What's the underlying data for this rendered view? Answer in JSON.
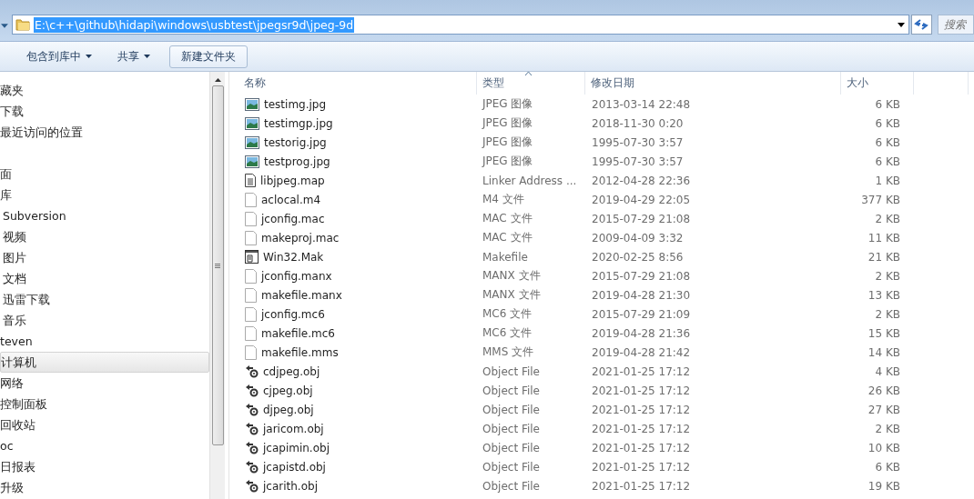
{
  "address_bar": {
    "path": "E:\\c++\\github\\hidapi\\windows\\usbtest\\jpegsr9d\\jpeg-9d",
    "text_selected": true
  },
  "search": {
    "placeholder": "搜索"
  },
  "toolbar": [
    {
      "label": "包含到库中",
      "dropdown": true
    },
    {
      "label": "共享",
      "dropdown": true
    },
    {
      "label": "新建文件夹",
      "dropdown": false
    }
  ],
  "sidebar": {
    "items": [
      {
        "label": "藏夹",
        "selected": false
      },
      {
        "label": "下载",
        "selected": false
      },
      {
        "label": "最近访问的位置",
        "selected": false
      },
      {
        "label": "面",
        "selected": false
      },
      {
        "label": "库",
        "selected": false,
        "children": [
          {
            "label": "Subversion",
            "selected": false
          },
          {
            "label": "视频",
            "selected": false
          },
          {
            "label": "图片",
            "selected": false
          },
          {
            "label": "文档",
            "selected": false
          },
          {
            "label": "迅雷下载",
            "selected": false
          },
          {
            "label": "音乐",
            "selected": false
          }
        ]
      },
      {
        "label": "teven",
        "selected": false
      },
      {
        "label": "计算机",
        "selected": true
      },
      {
        "label": "网络",
        "selected": false
      },
      {
        "label": "控制面板",
        "selected": false
      },
      {
        "label": "回收站",
        "selected": false
      },
      {
        "label": "oc",
        "selected": false
      },
      {
        "label": "日报表",
        "selected": false
      },
      {
        "label": "升级",
        "selected": false
      }
    ]
  },
  "table": {
    "columns": [
      {
        "label": "名称",
        "sorted": false
      },
      {
        "label": "类型",
        "sorted": true
      },
      {
        "label": "修改日期",
        "sorted": false
      },
      {
        "label": "大小",
        "sorted": false
      }
    ],
    "rows": [
      {
        "kind": "image",
        "name": "testimg.jpg",
        "type": "JPEG 图像",
        "date": "2013-03-14 22:48",
        "size": "6 KB"
      },
      {
        "kind": "image",
        "name": "testimgp.jpg",
        "type": "JPEG 图像",
        "date": "2018-11-30 0:20",
        "size": "6 KB"
      },
      {
        "kind": "image",
        "name": "testorig.jpg",
        "type": "JPEG 图像",
        "date": "1995-07-30 3:57",
        "size": "6 KB"
      },
      {
        "kind": "image",
        "name": "testprog.jpg",
        "type": "JPEG 图像",
        "date": "1995-07-30 3:57",
        "size": "6 KB"
      },
      {
        "kind": "text",
        "name": "libjpeg.map",
        "type": "Linker Address ...",
        "date": "2012-04-28 22:36",
        "size": "1 KB"
      },
      {
        "kind": "blank",
        "name": "aclocal.m4",
        "type": "M4 文件",
        "date": "2019-04-29 22:05",
        "size": "377 KB"
      },
      {
        "kind": "blank",
        "name": "jconfig.mac",
        "type": "MAC 文件",
        "date": "2015-07-29 21:08",
        "size": "2 KB"
      },
      {
        "kind": "blank",
        "name": "makeproj.mac",
        "type": "MAC 文件",
        "date": "2009-04-09 3:32",
        "size": "11 KB"
      },
      {
        "kind": "makefile",
        "name": "Win32.Mak",
        "type": "Makefile",
        "date": "2020-02-25 8:56",
        "size": "21 KB"
      },
      {
        "kind": "blank",
        "name": "jconfig.manx",
        "type": "MANX 文件",
        "date": "2015-07-29 21:08",
        "size": "2 KB"
      },
      {
        "kind": "blank",
        "name": "makefile.manx",
        "type": "MANX 文件",
        "date": "2019-04-28 21:30",
        "size": "13 KB"
      },
      {
        "kind": "blank",
        "name": "jconfig.mc6",
        "type": "MC6 文件",
        "date": "2015-07-29 21:09",
        "size": "2 KB"
      },
      {
        "kind": "blank",
        "name": "makefile.mc6",
        "type": "MC6 文件",
        "date": "2019-04-28 21:36",
        "size": "15 KB"
      },
      {
        "kind": "blank",
        "name": "makefile.mms",
        "type": "MMS 文件",
        "date": "2019-04-28 21:42",
        "size": "14 KB"
      },
      {
        "kind": "object",
        "name": "cdjpeg.obj",
        "type": "Object File",
        "date": "2021-01-25 17:12",
        "size": "4 KB"
      },
      {
        "kind": "object",
        "name": "cjpeg.obj",
        "type": "Object File",
        "date": "2021-01-25 17:12",
        "size": "26 KB"
      },
      {
        "kind": "object",
        "name": "djpeg.obj",
        "type": "Object File",
        "date": "2021-01-25 17:12",
        "size": "27 KB"
      },
      {
        "kind": "object",
        "name": "jaricom.obj",
        "type": "Object File",
        "date": "2021-01-25 17:12",
        "size": "2 KB"
      },
      {
        "kind": "object",
        "name": "jcapimin.obj",
        "type": "Object File",
        "date": "2021-01-25 17:12",
        "size": "10 KB"
      },
      {
        "kind": "object",
        "name": "jcapistd.obj",
        "type": "Object File",
        "date": "2021-01-25 17:12",
        "size": "6 KB"
      },
      {
        "kind": "object",
        "name": "jcarith.obj",
        "type": "Object File",
        "date": "2021-01-25 17:12",
        "size": "19 KB"
      }
    ]
  }
}
